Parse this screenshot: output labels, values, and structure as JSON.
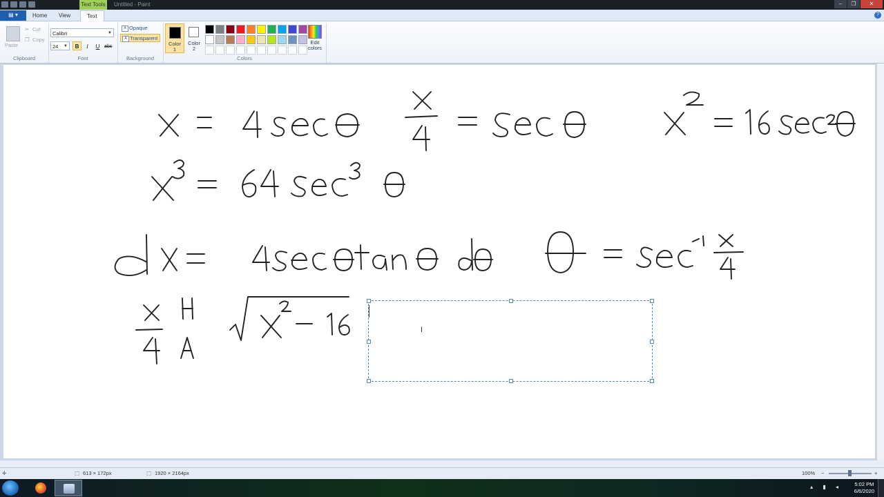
{
  "title_bar": {
    "context_tab": "Text Tools",
    "window_title": "Untitled - Paint",
    "controls": [
      "–",
      "❐",
      "✕"
    ]
  },
  "ribbon_tabs": {
    "file": "▤ ▾",
    "tabs": [
      "Home",
      "View",
      "Text"
    ],
    "active": "Text"
  },
  "clipboard": {
    "paste": "Paste",
    "cut": "Cut",
    "copy": "Copy",
    "group": "Clipboard"
  },
  "font": {
    "family": "Calibri",
    "size": "24",
    "bold": "B",
    "italic": "I",
    "underline": "U",
    "strike": "abc",
    "group": "Font"
  },
  "background": {
    "opaque": "Opaque",
    "transparent": "Transparent",
    "group": "Background"
  },
  "colors": {
    "color1_line1": "Color",
    "color1_line2": "1",
    "color2_line1": "Color",
    "color2_line2": "2",
    "edit_line1": "Edit",
    "edit_line2": "colors",
    "group": "Colors",
    "color1_value": "#000000",
    "color2_value": "#ffffff",
    "palette_row1": [
      "#000000",
      "#7f7f7f",
      "#880015",
      "#ed1c24",
      "#ff7f27",
      "#fff200",
      "#22b14c",
      "#00a2e8",
      "#3f48cc",
      "#a349a4"
    ],
    "palette_row2": [
      "#ffffff",
      "#c3c3c3",
      "#b97a57",
      "#ffaec9",
      "#ffc90e",
      "#efe4b0",
      "#b5e61d",
      "#99d9ea",
      "#7092be",
      "#c8bfe7"
    ],
    "palette_row3": [
      "#ffffff",
      "#ffffff",
      "#ffffff",
      "#ffffff",
      "#ffffff",
      "#ffffff",
      "#ffffff",
      "#ffffff",
      "#ffffff",
      "#ffffff"
    ]
  },
  "status": {
    "selection_size": "613 × 172px",
    "canvas_size": "1920 × 2164px",
    "zoom": "100%"
  },
  "taskbar": {
    "time": "5:02 PM",
    "date": "6/6/2020"
  }
}
